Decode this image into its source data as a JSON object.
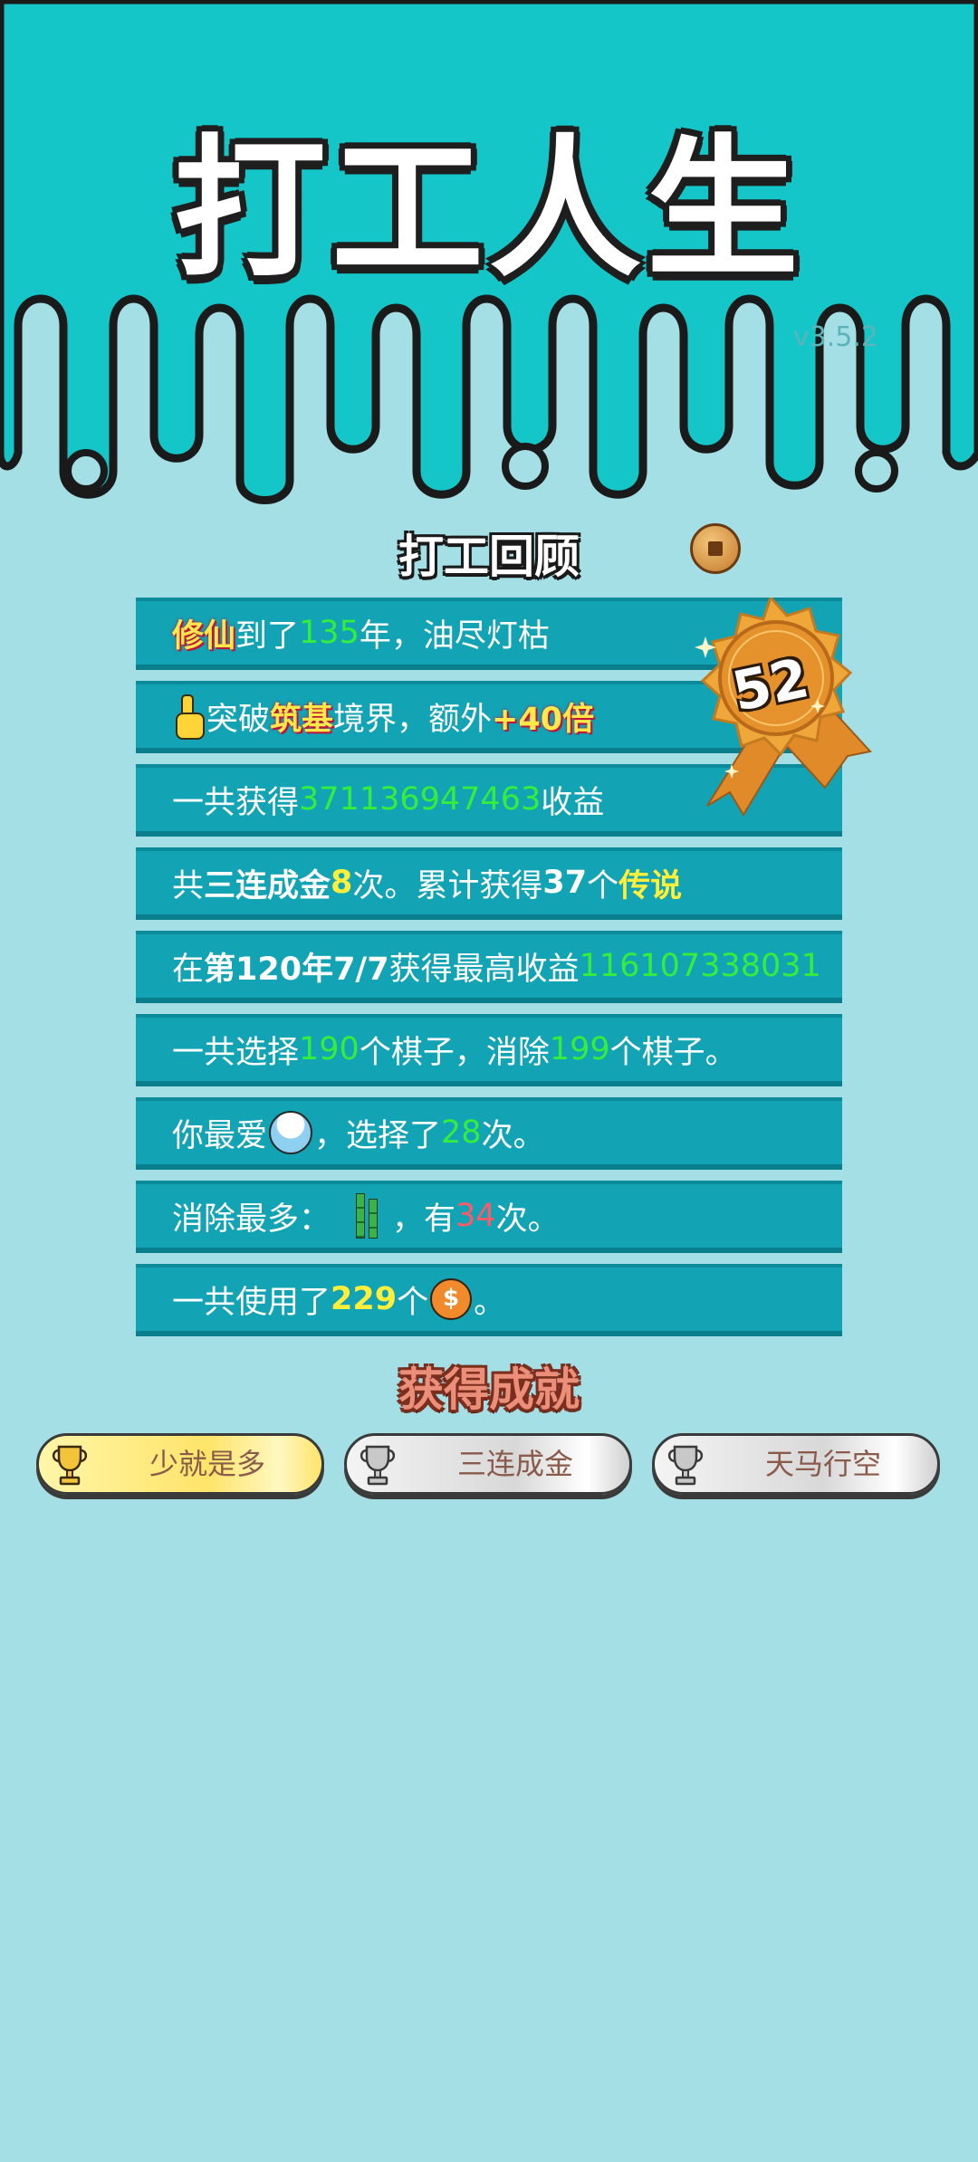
{
  "header": {
    "game_title": "打工人生",
    "version": "v3.5.2",
    "colors": {
      "top_band": "#15c6c9",
      "background": "#a3dfe5"
    }
  },
  "review": {
    "title": "打工回顾",
    "medal_value": "52",
    "rows": [
      {
        "a": "修仙",
        "b": "到了",
        "c": "135",
        "d": "年，油尽灯枯"
      },
      {
        "a": "突破",
        "b": "筑基",
        "c": "境界，额外",
        "d": "+40倍"
      },
      {
        "a": "一共获得",
        "b": "371136947463",
        "c": "收益"
      },
      {
        "a": "共",
        "b": "三连成金",
        "c": "8",
        "d": "次。累计获得",
        "e": "37",
        "f": "个",
        "g": "传说"
      },
      {
        "a": "在 ",
        "b": "第120年7/7",
        "c": " 获得最高收益",
        "d": "116107338031"
      },
      {
        "a": "一共选择",
        "b": "190",
        "c": "个棋子，消除",
        "d": "199",
        "e": "个棋子。"
      },
      {
        "a": "你最爱",
        "b": "，选择了",
        "c": "28",
        "d": "次。"
      },
      {
        "a": "消除最多：",
        "b": "，有",
        "c": "34",
        "d": "次。"
      },
      {
        "a": "一共使用了",
        "b": "229",
        "c": "个",
        "d": "。"
      }
    ]
  },
  "achievements": {
    "title": "获得成就",
    "items": [
      {
        "label": "少就是多",
        "tier": "gold"
      },
      {
        "label": "三连成金",
        "tier": "silver"
      },
      {
        "label": "天马行空",
        "tier": "silver"
      }
    ]
  }
}
